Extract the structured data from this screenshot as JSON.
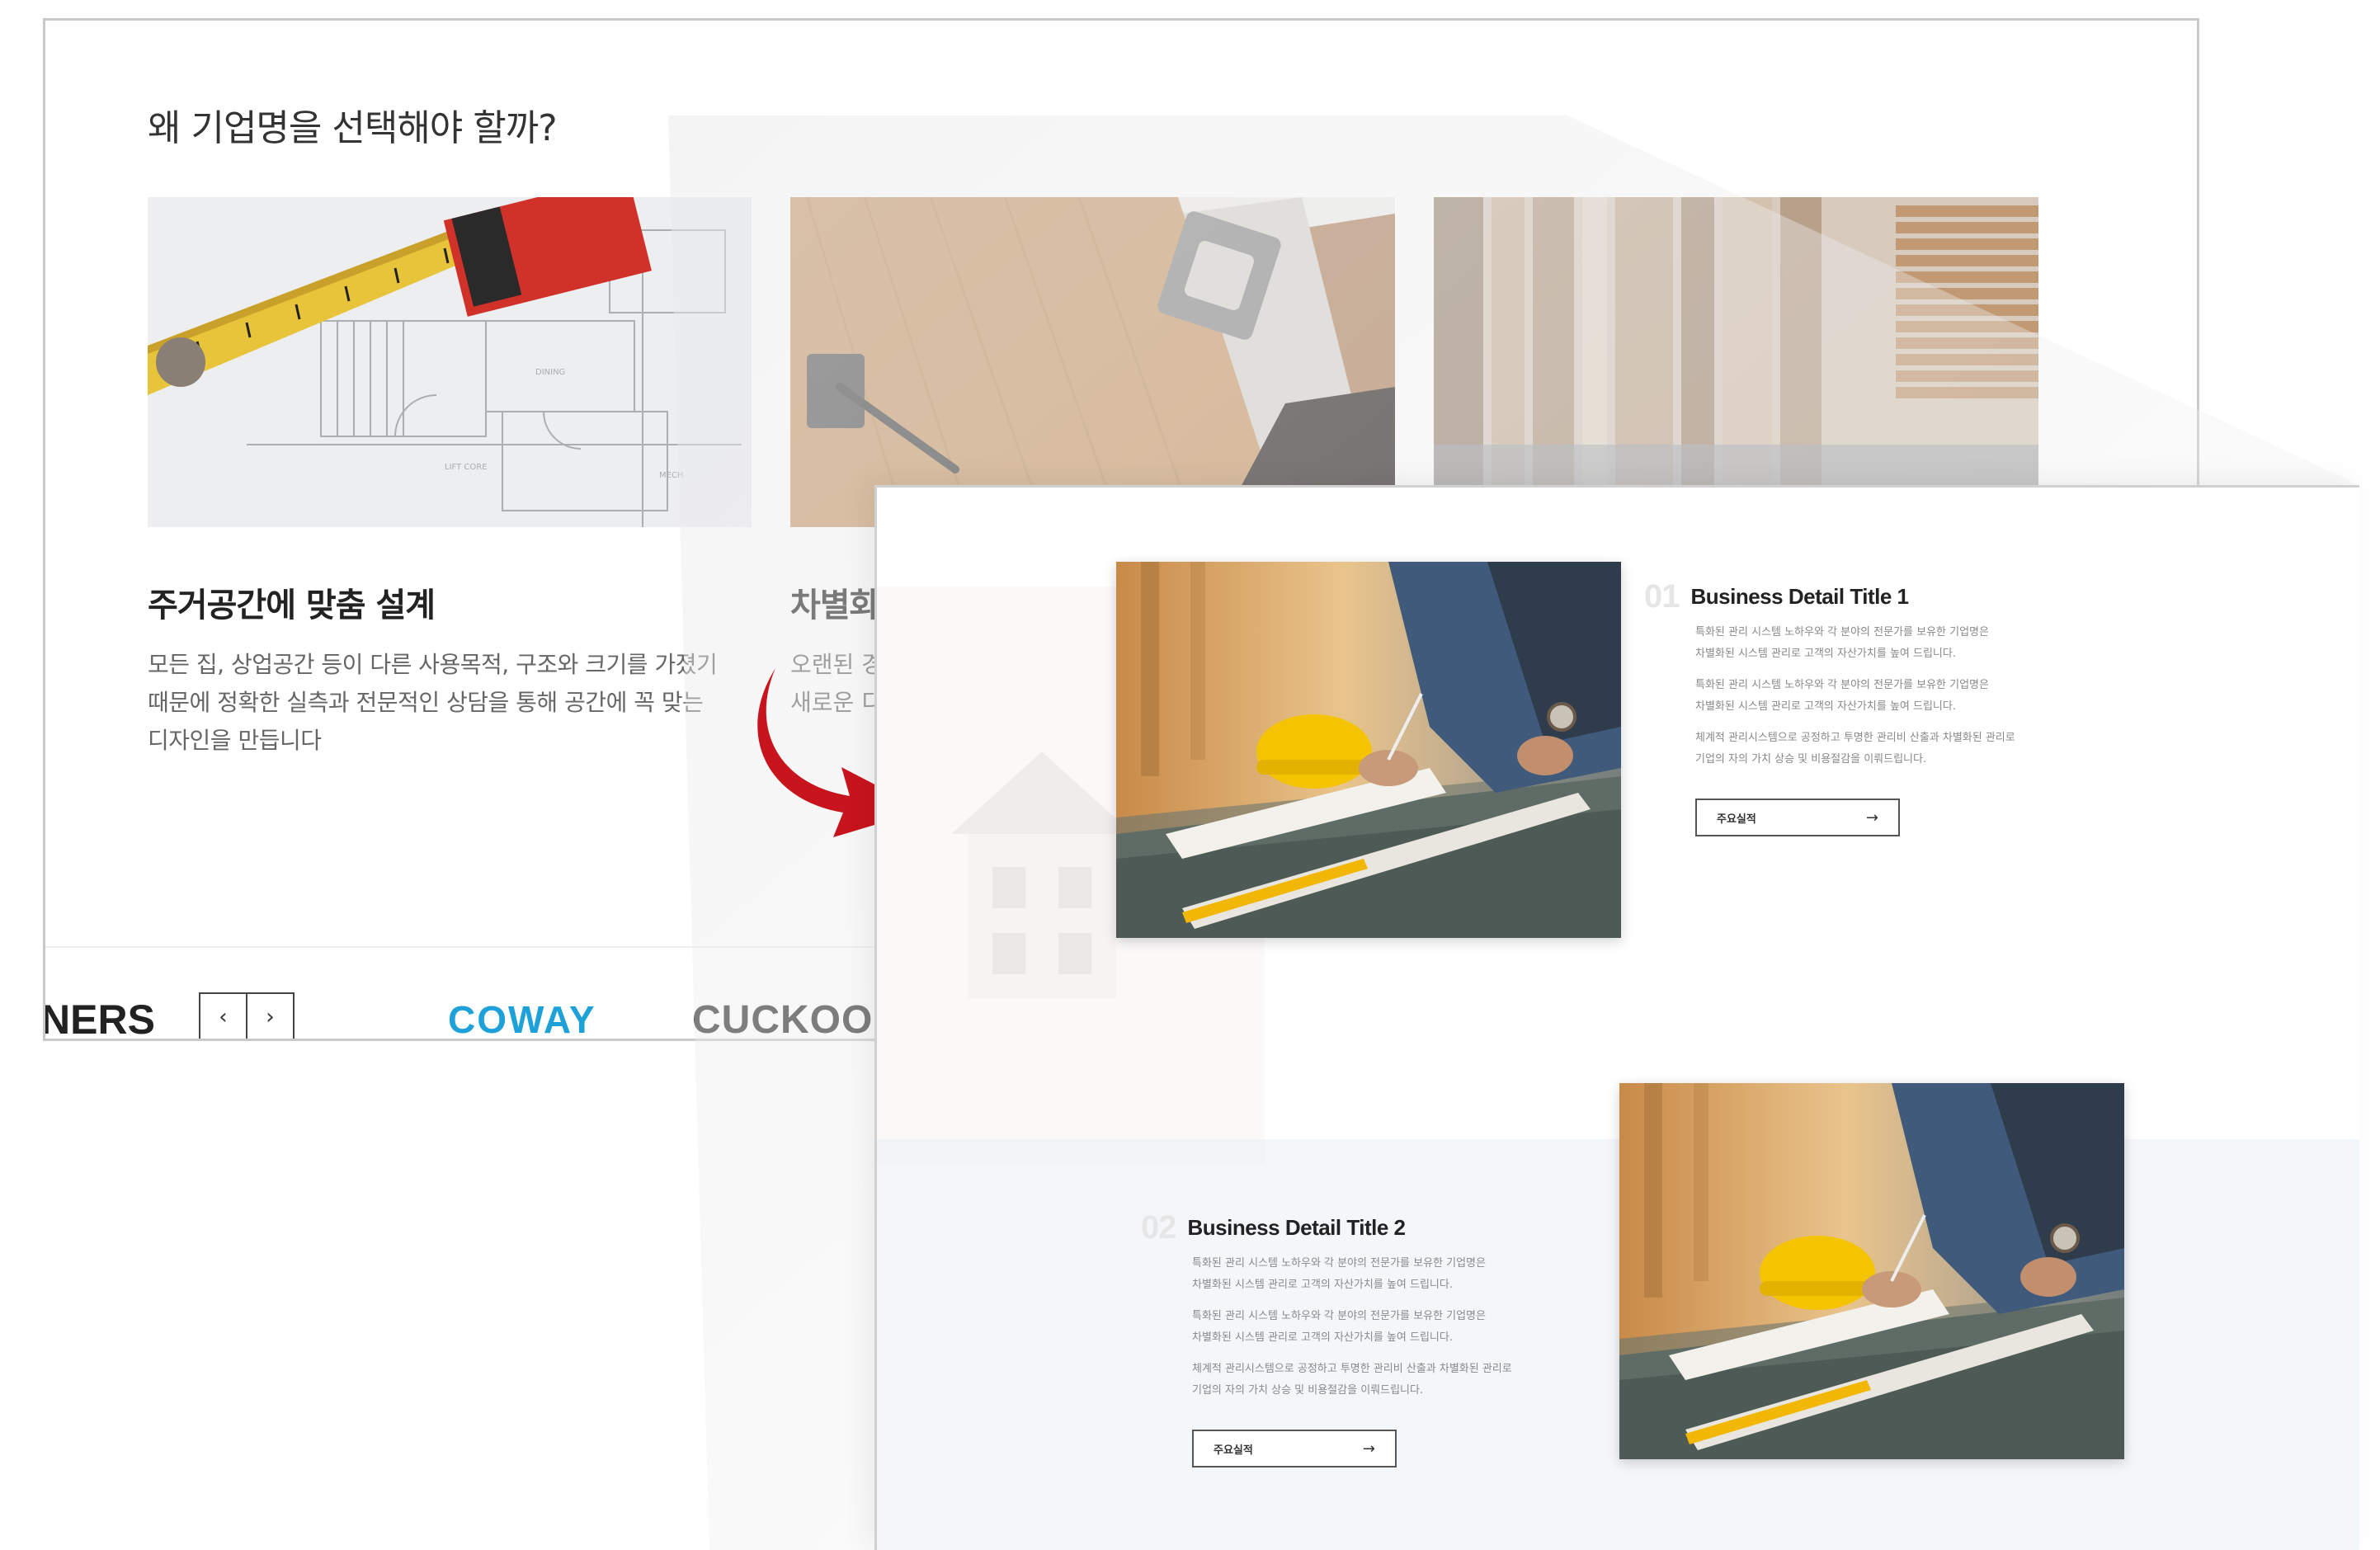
{
  "back_page": {
    "section_title": "왜 기업명을 선택해야 할까?",
    "cards": [
      {
        "title": "주거공간에 맞춤 설계",
        "desc_lines": [
          "모든 집, 상업공간 등이 다른 사용목적, 구조와 크기를 가졌기",
          "때문에 정확한 실측과 전문적인 상담을 통해 공간에 꼭 맞는",
          "디자인을 만듭니다"
        ]
      },
      {
        "title": "차별화",
        "desc_lines": [
          "오랜된 경",
          "새로운 디"
        ]
      }
    ],
    "partners": {
      "label": "NERS",
      "prev": "‹",
      "next": "›",
      "logos": [
        "COWAY",
        "CUCKOO"
      ]
    }
  },
  "front_page": {
    "details": [
      {
        "number": "01",
        "title": "Business Detail Title 1",
        "lines": [
          "특화된 관리 시스템 노하우와 각 분야의 전문가를 보유한 기업명은",
          "차별화된 시스템 관리로 고객의 자산가치를 높여 드립니다.",
          "특화된 관리 시스템 노하우와 각 분야의 전문가를 보유한 기업명은",
          "차별화된 시스템 관리로 고객의 자산가치를 높여 드립니다.",
          "체계적 관리시스템으로 공정하고 투명한 관리비 산출과 차별화된 관리로",
          "기업의 자의 가치 상승 및 비용절감을 이뤄드립니다."
        ],
        "button": "주요실적",
        "button_arrow": "→"
      },
      {
        "number": "02",
        "title": "Business Detail Title 2",
        "lines": [
          "특화된 관리 시스템 노하우와 각 분야의 전문가를 보유한 기업명은",
          "차별화된 시스템 관리로 고객의 자산가치를 높여 드립니다.",
          "특화된 관리 시스템 노하우와 각 분야의 전문가를 보유한 기업명은",
          "차별화된 시스템 관리로 고객의 자산가치를 높여 드립니다.",
          "체계적 관리시스템으로 공정하고 투명한 관리비 산출과 차별화된 관리로",
          "기업의 자의 가치 상승 및 비용절감을 이뤄드립니다."
        ],
        "button": "주요실적",
        "button_arrow": "→"
      }
    ]
  },
  "colors": {
    "accent_red": "#c8141c",
    "coway_blue": "#1ea0d8",
    "band_bg": "#f4f7fa"
  },
  "icons": [
    "arrow-curved-icon",
    "chevron-left-icon",
    "chevron-right-icon",
    "arrow-right-icon"
  ]
}
